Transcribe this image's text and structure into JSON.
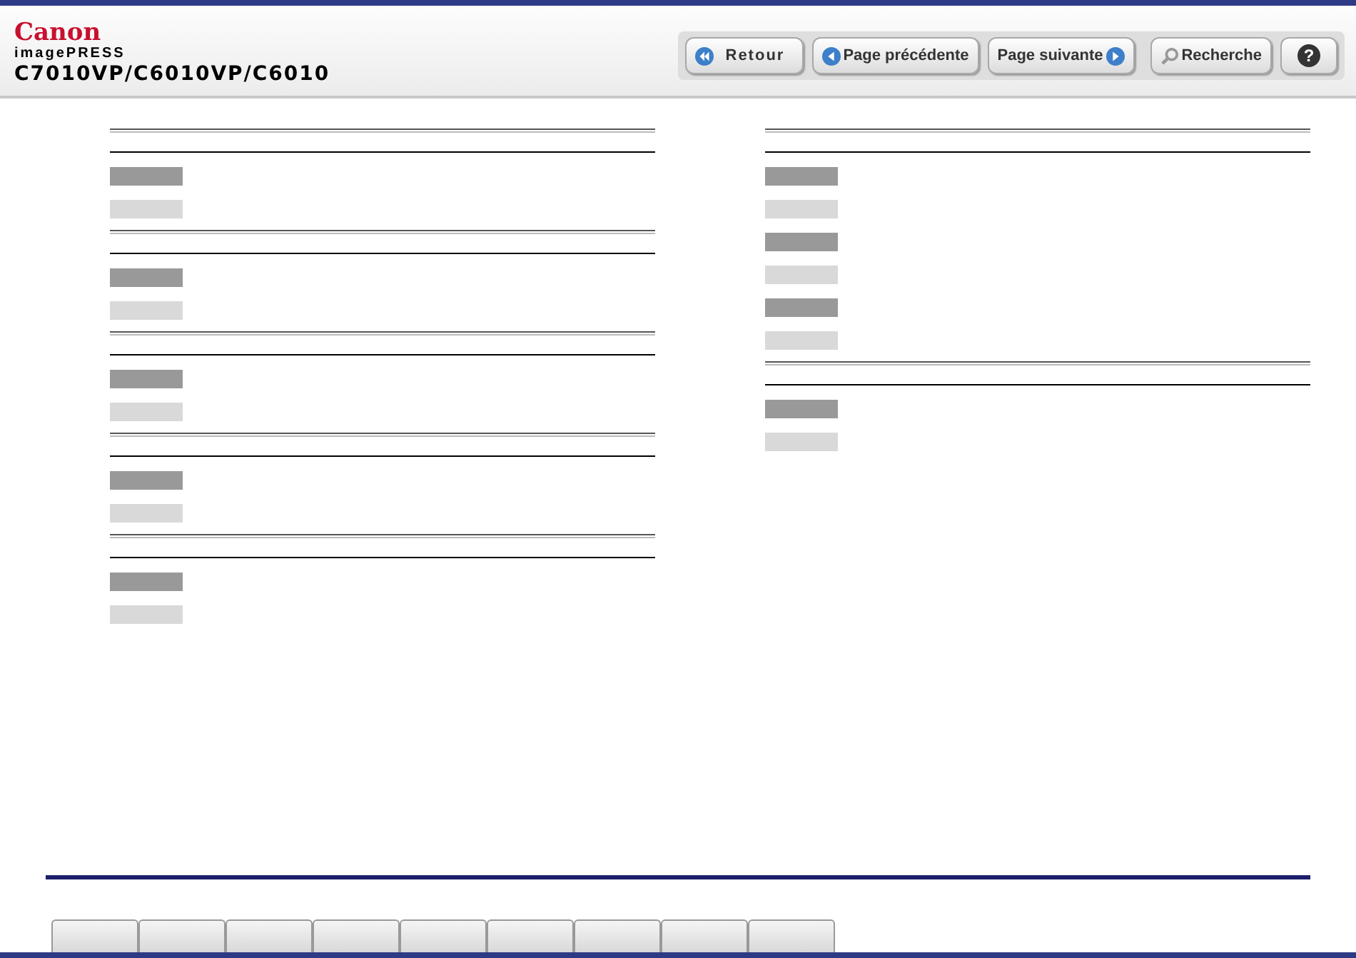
{
  "header": {
    "brand": "Canon",
    "product_line": "imagePRESS",
    "model": "C7010VP/C6010VP/C6010"
  },
  "nav_buttons": [
    {
      "label": "Retour",
      "kind": "back"
    },
    {
      "label": "Page précédente",
      "kind": "prev"
    },
    {
      "label": "Page suivante",
      "kind": "next"
    },
    {
      "label": "Recherche",
      "kind": "search"
    },
    {
      "label": "?",
      "kind": "help"
    }
  ],
  "columns": [
    {
      "sections": [
        {
          "rows": [
            {
              "kind": "dark"
            },
            {
              "kind": "light"
            }
          ]
        },
        {
          "rows": [
            {
              "kind": "dark"
            },
            {
              "kind": "light"
            }
          ]
        },
        {
          "rows": [
            {
              "kind": "dark"
            },
            {
              "kind": "light"
            }
          ]
        },
        {
          "rows": [
            {
              "kind": "dark"
            },
            {
              "kind": "light"
            }
          ]
        },
        {
          "rows": [
            {
              "kind": "dark"
            },
            {
              "kind": "light"
            }
          ]
        }
      ]
    },
    {
      "sections": [
        {
          "rows": [
            {
              "kind": "dark"
            },
            {
              "kind": "light"
            },
            {
              "kind": "dark"
            },
            {
              "kind": "light"
            },
            {
              "kind": "dark"
            },
            {
              "kind": "light"
            }
          ]
        },
        {
          "rows": [
            {
              "kind": "dark"
            },
            {
              "kind": "light"
            }
          ]
        }
      ]
    }
  ],
  "bottom_tabs": [
    {
      "kind": "tab"
    },
    {
      "kind": "tab"
    },
    {
      "kind": "tab"
    },
    {
      "kind": "tab"
    },
    {
      "kind": "tab"
    },
    {
      "kind": "tab"
    },
    {
      "kind": "tab"
    },
    {
      "kind": "tab"
    },
    {
      "kind": "tab"
    }
  ]
}
